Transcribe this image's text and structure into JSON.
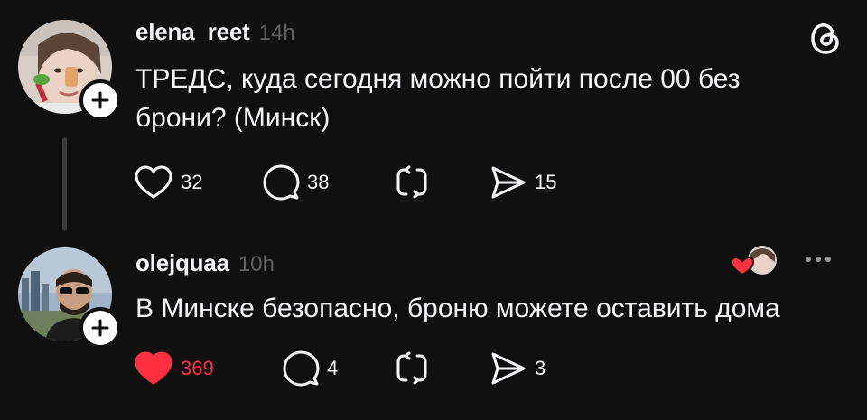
{
  "posts": [
    {
      "username": "elena_reet",
      "time": "14h",
      "text": "ТРЕДС, куда сегодня можно пойти после 00 без\nброни? (Минск)",
      "likes": "32",
      "replies": "38",
      "shares": "15",
      "liked": false,
      "avatar_icon": "user-avatar"
    },
    {
      "username": "olejquaa",
      "time": "10h",
      "text": "В Минске безопасно, броню можете оставить дома",
      "likes": "369",
      "replies": "4",
      "shares": "3",
      "liked": true,
      "avatar_icon": "user-avatar"
    }
  ],
  "icons": {
    "app_logo": "threads-logo",
    "follow": "plus-icon",
    "like": "heart-icon",
    "reply": "comment-icon",
    "repost": "repost-icon",
    "share": "send-icon",
    "more": "more-dots-icon"
  },
  "colors": {
    "background": "#101010",
    "text": "#f3f5f7",
    "muted": "#616161",
    "like_red": "#ff3040"
  }
}
